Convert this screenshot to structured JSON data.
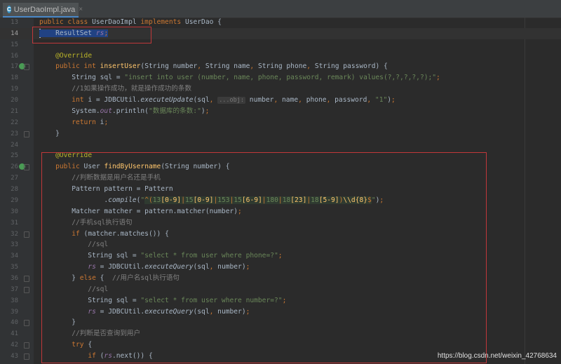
{
  "tab": {
    "title": "UserDaoImpl.java",
    "icon": "class-icon",
    "icon_letter": "C",
    "close": "×"
  },
  "watermark": "https://blog.csdn.net/weixin_42768634",
  "hint_label": "...obj:",
  "colors": {
    "keyword": "#cc7832",
    "string": "#6a8759",
    "comment": "#808080",
    "annotation": "#bbb529",
    "method": "#ffc66d",
    "field": "#9876aa",
    "text": "#a9b7c6",
    "highlight_box": "#c0383a"
  },
  "lines": [
    {
      "n": "13",
      "t": [
        [
          "k",
          "public class "
        ],
        [
          "",
          "UserDaoImpl "
        ],
        [
          "k",
          "implements "
        ],
        [
          "",
          "UserDao {"
        ]
      ]
    },
    {
      "n": "14",
      "cur": true,
      "t": [
        [
          "sel",
          "    ResultSet "
        ],
        [
          "sel f",
          "rs"
        ],
        [
          "sel k",
          ";"
        ]
      ]
    },
    {
      "n": "15",
      "t": []
    },
    {
      "n": "16",
      "t": [
        [
          "",
          "    "
        ],
        [
          "a",
          "@Override"
        ]
      ]
    },
    {
      "n": "17",
      "mark": true,
      "t": [
        [
          "",
          "    "
        ],
        [
          "k",
          "public int "
        ],
        [
          "m",
          "insertUser"
        ],
        [
          "",
          "(String number"
        ],
        [
          "k",
          ", "
        ],
        [
          "",
          "String name"
        ],
        [
          "k",
          ", "
        ],
        [
          "",
          "String phone"
        ],
        [
          "k",
          ", "
        ],
        [
          "",
          "String password) {"
        ]
      ]
    },
    {
      "n": "18",
      "t": [
        [
          "",
          "        String sql = "
        ],
        [
          "s",
          "\"insert into user (number, name, phone, password, remark) values(?,?,?,?,?);\""
        ],
        [
          "k",
          ";"
        ]
      ]
    },
    {
      "n": "19",
      "t": [
        [
          "c",
          "        //1如果操作成功，就是操作成功的条数"
        ]
      ]
    },
    {
      "n": "20",
      "t": [
        [
          "",
          "        "
        ],
        [
          "k",
          "int "
        ],
        [
          "",
          "i = JDBCUtil."
        ],
        [
          "i",
          "executeUpdate"
        ],
        [
          "",
          "(sql"
        ],
        [
          "k",
          ", "
        ],
        [
          "h",
          "...obj:"
        ],
        [
          "",
          " number"
        ],
        [
          "k",
          ", "
        ],
        [
          "",
          "name"
        ],
        [
          "k",
          ", "
        ],
        [
          "",
          "phone"
        ],
        [
          "k",
          ", "
        ],
        [
          "",
          "password"
        ],
        [
          "k",
          ", "
        ],
        [
          "s",
          "\"1\""
        ],
        [
          "",
          ")"
        ],
        [
          "k",
          ";"
        ]
      ]
    },
    {
      "n": "21",
      "t": [
        [
          "",
          "        System."
        ],
        [
          "f",
          "out"
        ],
        [
          "",
          ".println("
        ],
        [
          "s",
          "\"数据库的条数:\""
        ],
        [
          "",
          ")"
        ],
        [
          "k",
          ";"
        ]
      ]
    },
    {
      "n": "22",
      "t": [
        [
          "",
          "        "
        ],
        [
          "k",
          "return "
        ],
        [
          "",
          "i"
        ],
        [
          "k",
          ";"
        ]
      ]
    },
    {
      "n": "23",
      "t": [
        [
          "",
          "    }"
        ]
      ]
    },
    {
      "n": "24",
      "t": []
    },
    {
      "n": "25",
      "t": [
        [
          "",
          "    "
        ],
        [
          "a",
          "@Override"
        ]
      ]
    },
    {
      "n": "26",
      "mark": true,
      "t": [
        [
          "",
          "    "
        ],
        [
          "k",
          "public "
        ],
        [
          "",
          "User "
        ],
        [
          "m",
          "findByUsername"
        ],
        [
          "",
          "(String number) {"
        ]
      ]
    },
    {
      "n": "27",
      "t": [
        [
          "c",
          "        //判断数据是用户名还是手机"
        ]
      ]
    },
    {
      "n": "28",
      "t": [
        [
          "",
          "        Pattern pattern = Pattern"
        ]
      ]
    },
    {
      "n": "29",
      "t": [
        [
          "",
          "                ."
        ],
        [
          "i",
          "compile"
        ],
        [
          "",
          "("
        ],
        [
          "s",
          "\""
        ],
        [
          "re rp",
          "^("
        ],
        [
          "re s",
          "13"
        ],
        [
          "re rb",
          "[0-9]"
        ],
        [
          "re rp",
          "|"
        ],
        [
          "re s",
          "15"
        ],
        [
          "re rb",
          "[0-9]"
        ],
        [
          "re rp",
          "|"
        ],
        [
          "re s",
          "153"
        ],
        [
          "re rp",
          "|"
        ],
        [
          "re s",
          "15"
        ],
        [
          "re rb",
          "[6-9]"
        ],
        [
          "re rp",
          "|"
        ],
        [
          "re s",
          "180"
        ],
        [
          "re rp",
          "|"
        ],
        [
          "re s",
          "18"
        ],
        [
          "re rb",
          "[23]"
        ],
        [
          "re rp",
          "|"
        ],
        [
          "re s",
          "18"
        ],
        [
          "re rb",
          "[5-9]"
        ],
        [
          "re rp",
          ")"
        ],
        [
          "re rb",
          "\\\\d"
        ],
        [
          "re rb",
          "{8}"
        ],
        [
          "re rp",
          "$"
        ],
        [
          "s",
          "\""
        ],
        [
          "",
          ")"
        ],
        [
          "k",
          ";"
        ]
      ]
    },
    {
      "n": "30",
      "t": [
        [
          "",
          "        Matcher matcher = pattern.matcher(number)"
        ],
        [
          "k",
          ";"
        ]
      ]
    },
    {
      "n": "31",
      "t": [
        [
          "c",
          "        //手机sql执行语句"
        ]
      ]
    },
    {
      "n": "32",
      "t": [
        [
          "",
          "        "
        ],
        [
          "k",
          "if "
        ],
        [
          "",
          "(matcher.matches()) {"
        ]
      ]
    },
    {
      "n": "33",
      "t": [
        [
          "c",
          "            //sql"
        ]
      ]
    },
    {
      "n": "34",
      "t": [
        [
          "",
          "            String sql = "
        ],
        [
          "s",
          "\"select * from user where phone=?\""
        ],
        [
          "k",
          ";"
        ]
      ]
    },
    {
      "n": "35",
      "t": [
        [
          "",
          "            "
        ],
        [
          "f",
          "rs"
        ],
        [
          "",
          " = JDBCUtil."
        ],
        [
          "i",
          "executeQuery"
        ],
        [
          "",
          "(sql"
        ],
        [
          "k",
          ", "
        ],
        [
          "",
          "number)"
        ],
        [
          "k",
          ";"
        ]
      ]
    },
    {
      "n": "36",
      "t": [
        [
          "",
          "        } "
        ],
        [
          "k",
          "else "
        ],
        [
          "",
          "{  "
        ],
        [
          "c",
          "//用户名sql执行语句"
        ]
      ]
    },
    {
      "n": "37",
      "t": [
        [
          "c",
          "            //sql"
        ]
      ]
    },
    {
      "n": "38",
      "t": [
        [
          "",
          "            String sql = "
        ],
        [
          "s",
          "\"select * from user where number=?\""
        ],
        [
          "k",
          ";"
        ]
      ]
    },
    {
      "n": "39",
      "t": [
        [
          "",
          "            "
        ],
        [
          "f",
          "rs"
        ],
        [
          "",
          " = JDBCUtil."
        ],
        [
          "i",
          "executeQuery"
        ],
        [
          "",
          "(sql"
        ],
        [
          "k",
          ", "
        ],
        [
          "",
          "number)"
        ],
        [
          "k",
          ";"
        ]
      ]
    },
    {
      "n": "40",
      "t": [
        [
          "",
          "        }"
        ]
      ]
    },
    {
      "n": "41",
      "t": [
        [
          "c",
          "        //判断是否查询到用户"
        ]
      ]
    },
    {
      "n": "42",
      "t": [
        [
          "",
          "        "
        ],
        [
          "k",
          "try "
        ],
        [
          "",
          "{"
        ]
      ]
    },
    {
      "n": "43",
      "t": [
        [
          "",
          "            "
        ],
        [
          "k",
          "if "
        ],
        [
          "",
          "("
        ],
        [
          "f",
          "rs"
        ],
        [
          "",
          ".next()) {"
        ]
      ]
    }
  ]
}
